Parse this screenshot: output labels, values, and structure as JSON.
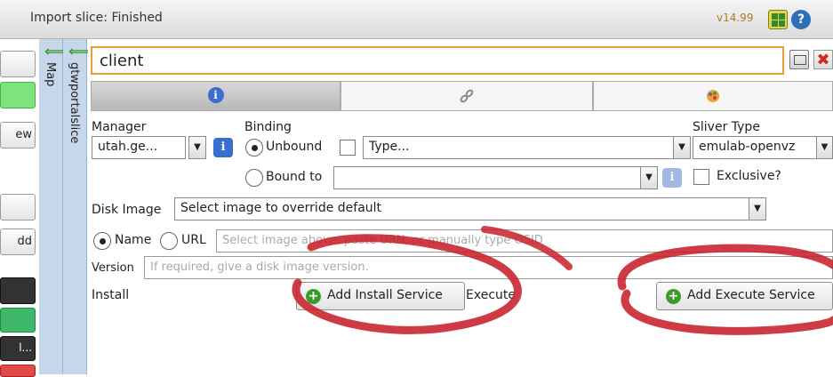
{
  "titlebar": {
    "title": "Import slice: Finished",
    "version": "v14.99",
    "help_label": "?"
  },
  "left_buttons": {
    "new_label": "ew",
    "add_label": "dd",
    "more_label": "l..."
  },
  "side_panes": {
    "map_label": "Map",
    "slice_label": "gtwportalslice"
  },
  "node": {
    "name": "client"
  },
  "tabs": {
    "info_glyph": "i"
  },
  "manager": {
    "label": "Manager",
    "value": "utah.ge..."
  },
  "binding": {
    "label": "Binding",
    "unbound_label": "Unbound",
    "type_value": "Type...",
    "bound_to_label": "Bound to",
    "bound_to_value": ""
  },
  "sliver": {
    "label": "Sliver Type",
    "value": "emulab-openvz",
    "exclusive_label": "Exclusive?"
  },
  "disk_image": {
    "label": "Disk Image",
    "value": "Select image to override default",
    "name_label": "Name",
    "url_label": "URL",
    "url_placeholder": "Select image above, paste URN, or manually type OSID"
  },
  "version_field": {
    "label": "Version",
    "placeholder": "If required, give a disk image version."
  },
  "services": {
    "install_label": "Install",
    "add_install_label": "Add Install Service",
    "execute_label": "Execute",
    "add_execute_label": "Add Execute Service"
  },
  "colors": {
    "accent_orange": "#e8a03a",
    "pane_blue": "#c7d7ea",
    "annotation_red": "#c8202a",
    "add_green": "#3a9a2a"
  }
}
